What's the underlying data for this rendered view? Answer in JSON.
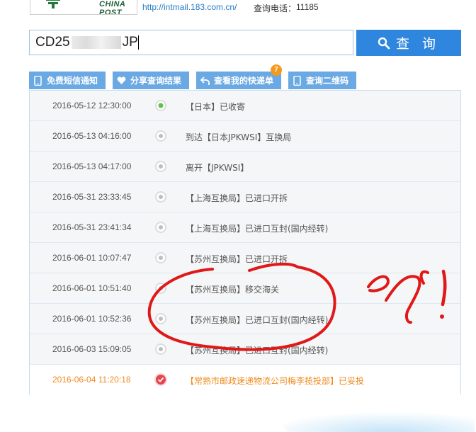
{
  "header": {
    "logo_text": "CHINA POST",
    "url": "http://intmail.183.com.cn/",
    "phone_label": "查询电话：",
    "phone_number": "11185"
  },
  "search": {
    "value_prefix": "CD25",
    "value_suffix": "JP",
    "button_label": "查 询"
  },
  "actions": [
    {
      "label": "免费短信通知",
      "icon": "phone-icon"
    },
    {
      "label": "分享查询结果",
      "icon": "heart-icon"
    },
    {
      "label": "查看我的快递单",
      "icon": "back-arrow-icon",
      "badge": "7"
    },
    {
      "label": "查询二维码",
      "icon": "phone-icon"
    }
  ],
  "tracking": [
    {
      "time": "2016-05-12 12:30:00",
      "desc": "【日本】已收寄",
      "status": "start"
    },
    {
      "time": "2016-05-13 04:16:00",
      "desc": "到达【日本JPKWSI】互换局",
      "status": "normal"
    },
    {
      "time": "2016-05-13 04:17:00",
      "desc": "离开【JPKWSI】",
      "status": "normal"
    },
    {
      "time": "2016-05-31 23:33:45",
      "desc": "【上海互换局】已进口开拆",
      "status": "normal"
    },
    {
      "time": "2016-05-31 23:41:34",
      "desc": "【上海互换局】已进口互封(国内经转)",
      "status": "normal"
    },
    {
      "time": "2016-06-01 10:07:47",
      "desc": "【苏州互换局】已进口开拆",
      "status": "normal"
    },
    {
      "time": "2016-06-01 10:51:40",
      "desc": "【苏州互换局】移交海关",
      "status": "normal"
    },
    {
      "time": "2016-06-01 10:52:36",
      "desc": "【苏州互换局】已进口互封(国内经转)",
      "status": "normal"
    },
    {
      "time": "2016-06-03 15:09:05",
      "desc": "【苏州互换局】已进口互封(国内经转)",
      "status": "normal"
    },
    {
      "time": "2016-06-04 11:20:18",
      "desc": "【常熟市邮政速递物流公司梅李揽投部】已妥投",
      "status": "delivered"
    }
  ],
  "colors": {
    "accent": "#2e86de",
    "tab": "#6aa9e3",
    "delivered": "#f08a1d",
    "annotation": "#e01818",
    "start_dot": "#5cc24a",
    "end_dot": "#e5474d"
  },
  "annotation_text": "?!"
}
